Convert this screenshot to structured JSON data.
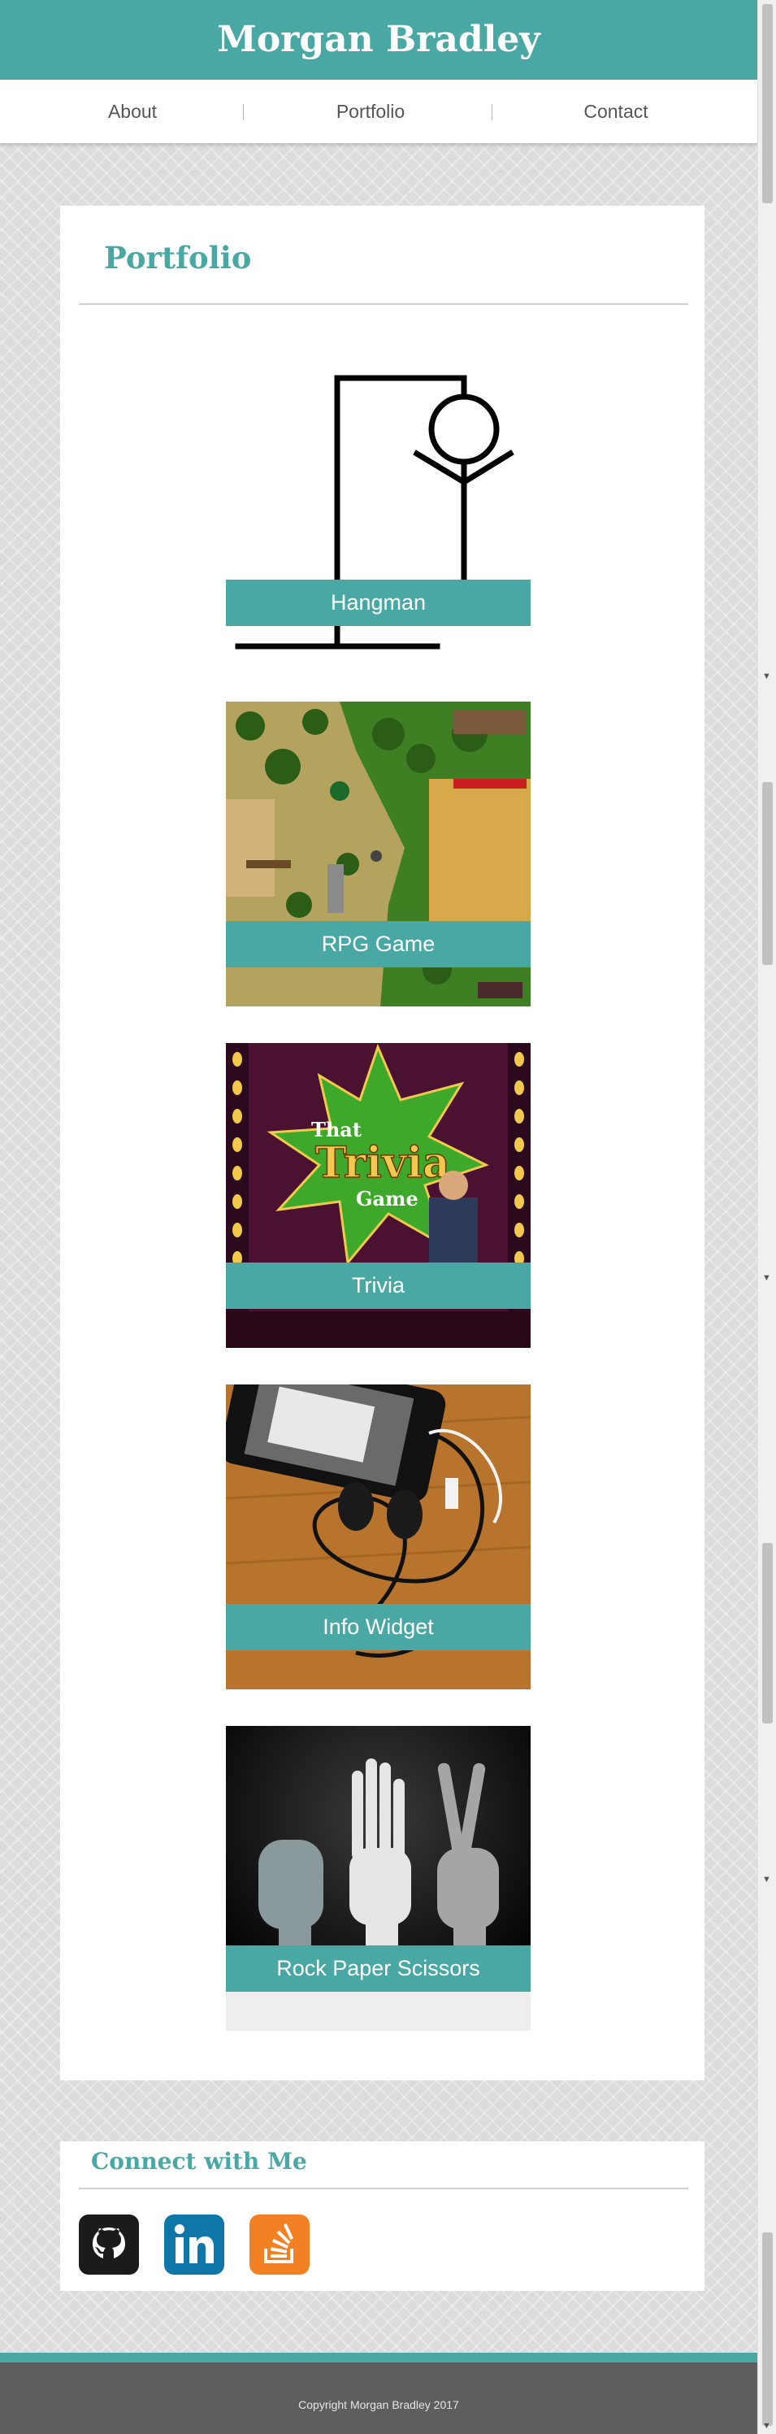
{
  "site": {
    "title": "Morgan Bradley"
  },
  "nav": {
    "items": [
      "About",
      "Portfolio",
      "Contact"
    ]
  },
  "portfolio": {
    "title": "Portfolio",
    "projects": [
      {
        "label": "Hangman"
      },
      {
        "label": "RPG Game"
      },
      {
        "label": "Trivia"
      },
      {
        "label": "Info Widget"
      },
      {
        "label": "Rock Paper Scissors"
      }
    ],
    "trivia_art": {
      "line1": "That",
      "line2": "Trivia",
      "line3": "Game"
    }
  },
  "connect": {
    "title": "Connect with Me",
    "links": [
      "github-icon",
      "linkedin-icon",
      "stackoverflow-icon"
    ]
  },
  "footer": {
    "copyright": "Copyright Morgan Bradley 2017"
  },
  "colors": {
    "accent": "#4aa8a4",
    "footer": "#5e5e5e",
    "github": "#1b1b1b",
    "linkedin": "#0e76a8",
    "stackoverflow": "#f48024"
  }
}
